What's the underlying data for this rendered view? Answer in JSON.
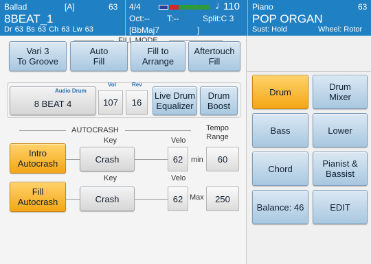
{
  "style": {
    "category": "Ballad",
    "tag": "[A]",
    "number": "63",
    "name": "8BEAT_1",
    "status_line": "Dr 63   Bs 63   Ch 63  Lw 63"
  },
  "performance": {
    "time_signature": "4/4",
    "tempo": "110",
    "octave": "Oct:--",
    "transpose": "T:--",
    "split": "Split:C 3",
    "chord": "[BbMaj7",
    "chord_close": "]"
  },
  "voice": {
    "category": "Piano",
    "number": "63",
    "name": "POP ORGAN",
    "sustain": "Sust: Hold",
    "wheel": "Wheel: Rotor"
  },
  "beat_indicator": {
    "colors": [
      "#2a3f9a",
      "#d22a2a",
      "#2e9a3a",
      "#2e9a3a",
      "#2e9a3a"
    ]
  },
  "fill_mode": {
    "title": "FILL MODE",
    "buttons": [
      "Vari 3\nTo Groove",
      "Auto\nFill",
      "Fill to\nArrange",
      "Aftertouch\nFill"
    ]
  },
  "audio_drum": {
    "label": "Audio Drum",
    "value": "8 BEAT 4",
    "vol_label": "Vol",
    "vol": "107",
    "rev_label": "Rev",
    "rev": "16",
    "live_drum_equalizer": "Live Drum\nEqualizer",
    "drum_boost": "Drum\nBoost"
  },
  "autocrash": {
    "title": "AUTOCRASH",
    "tempo_range_label": "Tempo\nRange",
    "intro_button": "Intro\nAutocrash",
    "fill_button": "Fill\nAutocrash",
    "key_label": "Key",
    "velo_label": "Velo",
    "intro_key": "Crash",
    "intro_velo": "62",
    "fill_key": "Crash",
    "fill_velo": "62",
    "min_label": "min",
    "min_value": "60",
    "max_label": "Max",
    "max_value": "250"
  },
  "right_menu": {
    "drum": "Drum",
    "drum_mixer": "Drum\nMixer",
    "bass": "Bass",
    "lower": "Lower",
    "chord": "Chord",
    "pianist_bassist": "Pianist &\nBassist",
    "balance": "Balance: 46",
    "edit": "EDIT"
  }
}
